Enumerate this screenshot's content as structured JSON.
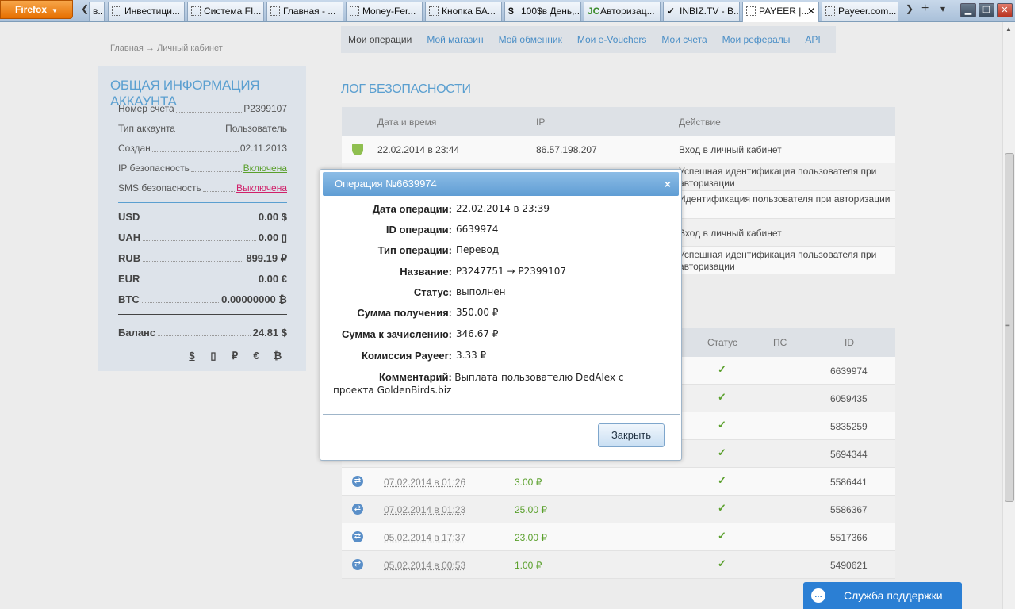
{
  "browser": {
    "firefox_label": "Firefox",
    "tabs": [
      {
        "label": "в...",
        "icon": ""
      },
      {
        "label": "Инвестици...",
        "icon": ""
      },
      {
        "label": "Система FI...",
        "icon": ""
      },
      {
        "label": "Главная - ...",
        "icon": ""
      },
      {
        "label": "Money-Fer...",
        "icon": ""
      },
      {
        "label": "Кнопка БА...",
        "icon": ""
      },
      {
        "label": "100$в День,...",
        "icon": "$"
      },
      {
        "label": "Авторизац...",
        "icon": "JC"
      },
      {
        "label": "INBIZ.TV - В...",
        "icon": "✓"
      },
      {
        "label": "PAYEER |...",
        "icon": ""
      },
      {
        "label": "Payeer.com...",
        "icon": ""
      }
    ],
    "close_tab_glyph": "✕",
    "scroll_left_glyph": "❮",
    "new_tab_glyph": "+",
    "list_tabs_glyph": "▾",
    "win_min": "▁",
    "win_restore": "❐",
    "win_close": "✕"
  },
  "breadcrumb": {
    "home": "Главная",
    "sep": "→",
    "current": "Личный кабинет"
  },
  "account": {
    "title": "ОБЩАЯ ИНФОРМАЦИЯ АККАУНТА",
    "rows": [
      {
        "label": "Номер счета",
        "value": "P2399107"
      },
      {
        "label": "Тип аккаунта",
        "value": "Пользователь"
      },
      {
        "label": "Создан",
        "value": "02.11.2013"
      },
      {
        "label": "IP безопасность",
        "value": "Включена"
      },
      {
        "label": "SMS безопасность",
        "value": "Выключена"
      }
    ],
    "balances": [
      {
        "code": "USD",
        "amount": "0.00 $"
      },
      {
        "code": "UAH",
        "amount": "0.00 ▯"
      },
      {
        "code": "RUB",
        "amount": "899.19 ₽"
      },
      {
        "code": "EUR",
        "amount": "0.00 €"
      },
      {
        "code": "BTC",
        "amount": "0.00000000 ₿"
      }
    ],
    "total_label": "Баланс",
    "total_value": "24.81 $",
    "currency_icons": [
      "$",
      "▯",
      "₽",
      "€",
      "₿"
    ]
  },
  "nav": {
    "items": [
      "Мои операции",
      "Мой магазин",
      "Мой обменник",
      "Мои e-Vouchers",
      "Мои счета",
      "Мои рефералы",
      "API"
    ]
  },
  "security_log": {
    "title": "ЛОГ БЕЗОПАСНОСТИ",
    "columns": [
      "Дата и время",
      "IP",
      "Действие"
    ],
    "rows": [
      {
        "datetime": "22.02.2014 в 23:44",
        "ip": "86.57.198.207",
        "action": "Вход в личный кабинет"
      },
      {
        "datetime": "",
        "ip": "",
        "action": "Успешная идентификация пользователя при авторизации"
      },
      {
        "datetime": "",
        "ip": "",
        "action": "Идентификация пользователя при авторизации"
      },
      {
        "datetime": "",
        "ip": "",
        "action": "Вход в личный кабинет"
      },
      {
        "datetime": "",
        "ip": "",
        "action": "Успешная идентификация пользователя при авторизации"
      }
    ]
  },
  "operations": {
    "columns": [
      "Статус",
      "ПС",
      "ID"
    ],
    "status_glyph": "✓",
    "rows": [
      {
        "date": "",
        "amount": "",
        "id": "6639974"
      },
      {
        "date": "",
        "amount": "",
        "id": "6059435"
      },
      {
        "date": "",
        "amount": "",
        "id": "5835259"
      },
      {
        "date": "",
        "amount": "",
        "id": "5694344"
      },
      {
        "date": "07.02.2014 в 01:26",
        "amount": "3.00 ₽",
        "id": "5586441"
      },
      {
        "date": "07.02.2014 в 01:23",
        "amount": "25.00 ₽",
        "id": "5586367"
      },
      {
        "date": "05.02.2014 в 17:37",
        "amount": "23.00 ₽",
        "id": "5517366"
      },
      {
        "date": "05.02.2014 в 00:53",
        "amount": "1.00 ₽",
        "id": "5490621"
      }
    ]
  },
  "modal": {
    "title": "Операция №6639974",
    "close_glyph": "×",
    "fields": [
      {
        "label": "Дата операции:",
        "value": "22.02.2014 в 23:39"
      },
      {
        "label": "ID операции:",
        "value": "6639974"
      },
      {
        "label": "Тип операции:",
        "value": "Перевод"
      },
      {
        "label": "Название:",
        "value": "P3247751 → P2399107"
      },
      {
        "label": "Статус:",
        "value": "выполнен"
      },
      {
        "label": "Сумма получения:",
        "value": "350.00 ₽"
      },
      {
        "label": "Сумма к зачислению:",
        "value": "346.67 ₽"
      },
      {
        "label": "Комиссия Payeer:",
        "value": "3.33 ₽"
      }
    ],
    "comment_label": "Комментарий:",
    "comment_value": "Выплата пользователю DedAlex с проекта GoldenBirds.biz",
    "close_button": "Закрыть"
  },
  "support": {
    "label": "Служба поддержки"
  },
  "colors": {
    "accent": "#5a9fd0",
    "link": "#4a8ec6",
    "success": "#5aa02c",
    "danger": "#d0206a",
    "support": "#2b7fd4"
  }
}
